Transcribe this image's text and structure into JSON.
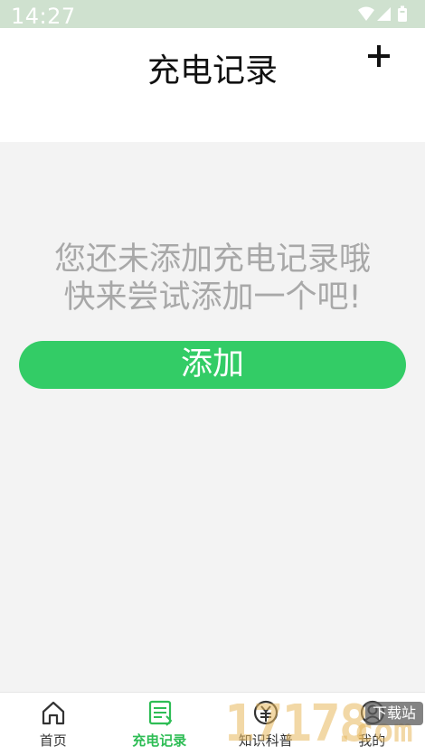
{
  "status_bar": {
    "time": "14:27",
    "icons": [
      "wifi-icon",
      "signal-icon",
      "battery-icon"
    ]
  },
  "header": {
    "title": "充电记录",
    "add_icon": "plus-icon"
  },
  "empty_state": {
    "line1": "您还未添加充电记录哦",
    "line2": "快来尝试添加一个吧!",
    "add_button_label": "添加"
  },
  "bottom_nav": {
    "items": [
      {
        "label": "首页",
        "icon": "home-icon",
        "active": false
      },
      {
        "label": "充电记录",
        "icon": "charging-record-icon",
        "active": true
      },
      {
        "label": "知识科普",
        "icon": "knowledge-icon",
        "active": false
      },
      {
        "label": "我的",
        "icon": "profile-icon",
        "active": false
      }
    ]
  },
  "watermark": {
    "number": "17178",
    "domain": ".com",
    "badge": "下载站"
  },
  "colors": {
    "accent": "#33cc66",
    "active_nav": "#2ebd55",
    "status_bar": "#cfe1cf",
    "empty_text": "#a8a8a8",
    "background": "#f3f3f3"
  }
}
